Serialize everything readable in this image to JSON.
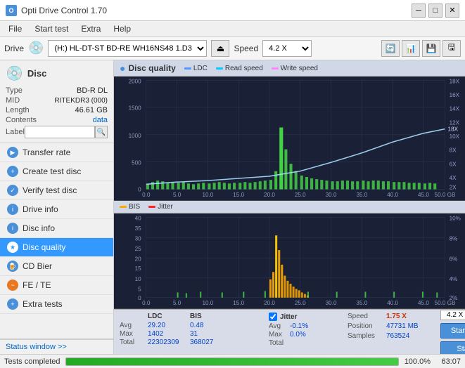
{
  "titleBar": {
    "title": "Opti Drive Control 1.70",
    "minimize": "─",
    "maximize": "□",
    "close": "✕"
  },
  "menuBar": {
    "items": [
      "File",
      "Start test",
      "Extra",
      "Help"
    ]
  },
  "toolbar": {
    "driveLabel": "Drive",
    "driveValue": "(H:)  HL-DT-ST BD-RE  WH16NS48 1.D3",
    "speedLabel": "Speed",
    "speedValue": "4.2 X"
  },
  "sidebar": {
    "discTitle": "Disc",
    "type": {
      "label": "Type",
      "value": "BD-R DL"
    },
    "mid": {
      "label": "MID",
      "value": "RITEKDR3 (000)"
    },
    "length": {
      "label": "Length",
      "value": "46.61 GB"
    },
    "contents": {
      "label": "Contents",
      "value": "data"
    },
    "label": {
      "label": "Label",
      "placeholder": ""
    },
    "navItems": [
      {
        "id": "transfer-rate",
        "label": "Transfer rate",
        "iconColor": "blue"
      },
      {
        "id": "create-test-disc",
        "label": "Create test disc",
        "iconColor": "blue"
      },
      {
        "id": "verify-test-disc",
        "label": "Verify test disc",
        "iconColor": "blue"
      },
      {
        "id": "drive-info",
        "label": "Drive info",
        "iconColor": "blue"
      },
      {
        "id": "disc-info",
        "label": "Disc info",
        "iconColor": "blue"
      },
      {
        "id": "disc-quality",
        "label": "Disc quality",
        "iconColor": "blue",
        "active": true
      },
      {
        "id": "cd-bier",
        "label": "CD Bier",
        "iconColor": "blue"
      },
      {
        "id": "fe-te",
        "label": "FE / TE",
        "iconColor": "orange"
      },
      {
        "id": "extra-tests",
        "label": "Extra tests",
        "iconColor": "blue"
      }
    ],
    "statusWindow": "Status window >>"
  },
  "chart": {
    "title": "Disc quality",
    "titleIcon": "●",
    "legend": [
      {
        "label": "LDC",
        "color": "#5599ff"
      },
      {
        "label": "Read speed",
        "color": "#00ccff"
      },
      {
        "label": "Write speed",
        "color": "#ff88ff"
      }
    ],
    "legend2": [
      {
        "label": "BIS",
        "color": "#ffaa00"
      },
      {
        "label": "Jitter",
        "color": "#ff0000"
      }
    ],
    "topChart": {
      "yLeft": [
        2000,
        1500,
        1000,
        500,
        0
      ],
      "yRight": [
        "18X",
        "16X",
        "14X",
        "12X",
        "10X",
        "8X",
        "6X",
        "4X",
        "2X"
      ],
      "xLabels": [
        "0.0",
        "5.0",
        "10.0",
        "15.0",
        "20.0",
        "25.0",
        "30.0",
        "35.0",
        "40.0",
        "45.0",
        "50.0 GB"
      ]
    },
    "bottomChart": {
      "yLeft": [
        40,
        35,
        30,
        25,
        20,
        15,
        10,
        5
      ],
      "yRight": [
        "10%",
        "8%",
        "6%",
        "4%",
        "2%"
      ],
      "xLabels": [
        "0.0",
        "5.0",
        "10.0",
        "15.0",
        "20.0",
        "25.0",
        "30.0",
        "35.0",
        "40.0",
        "45.0",
        "50.0 GB"
      ]
    }
  },
  "stats": {
    "columns": {
      "headers": [
        "",
        "LDC",
        "BIS"
      ],
      "rows": [
        {
          "label": "Avg",
          "ldc": "29.20",
          "bis": "0.48"
        },
        {
          "label": "Max",
          "ldc": "1402",
          "bis": "31"
        },
        {
          "label": "Total",
          "ldc": "22302309",
          "bis": "368027"
        }
      ]
    },
    "jitter": {
      "checked": true,
      "label": "Jitter",
      "rows": [
        {
          "label": "Avg",
          "value": "-0.1%"
        },
        {
          "label": "Max",
          "value": "0.0%"
        },
        {
          "label": "Total",
          "value": ""
        }
      ]
    },
    "speedPos": {
      "speedLabel": "Speed",
      "speedValue": "1.75 X",
      "posLabel": "Position",
      "posValue": "47731 MB",
      "samplesLabel": "Samples",
      "samplesValue": "763524"
    },
    "buttons": {
      "startFull": "Start full",
      "startPart": "Start part",
      "speedValue": "4.2 X"
    }
  },
  "statusBar": {
    "text": "Tests completed",
    "percent": "100.0%",
    "rightValue": "63:07",
    "fillWidth": "100"
  }
}
